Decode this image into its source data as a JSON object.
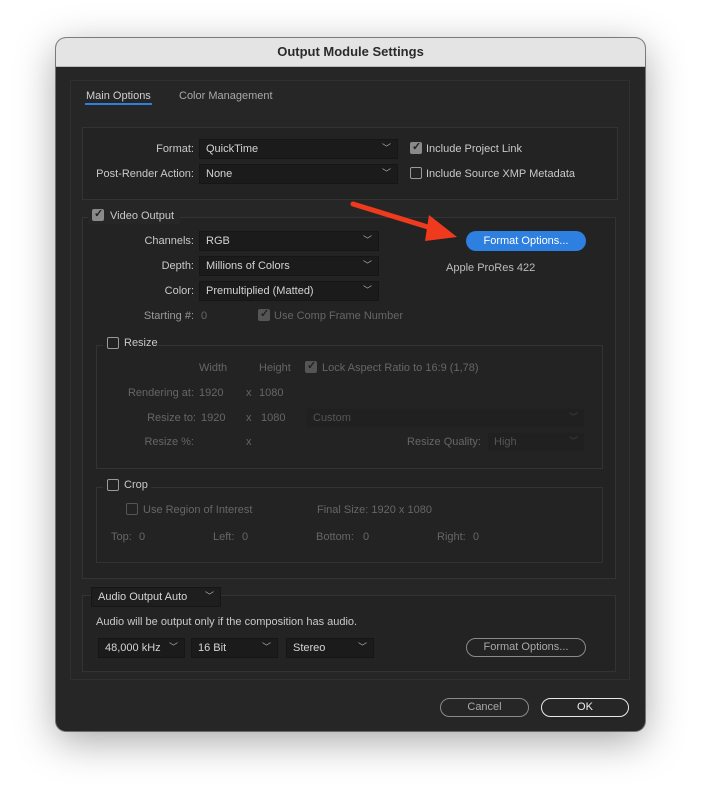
{
  "window": {
    "title": "Output Module Settings"
  },
  "tabs": [
    {
      "label": "Main Options",
      "active": true
    },
    {
      "label": "Color Management",
      "active": false
    }
  ],
  "main": {
    "format_label": "Format:",
    "format_value": "QuickTime",
    "post_render_label": "Post-Render Action:",
    "post_render_value": "None",
    "include_project_link": {
      "label": "Include Project Link",
      "checked": true
    },
    "include_xmp": {
      "label": "Include Source XMP Metadata",
      "checked": false
    }
  },
  "video": {
    "label": "Video Output",
    "checked": true,
    "channels_label": "Channels:",
    "channels_value": "RGB",
    "depth_label": "Depth:",
    "depth_value": "Millions of Colors",
    "color_label": "Color:",
    "color_value": "Premultiplied (Matted)",
    "starting_label": "Starting #:",
    "starting_value": "0",
    "use_comp_frame": {
      "label": "Use Comp Frame Number",
      "checked": true
    },
    "format_options_label": "Format Options...",
    "codec": "Apple ProRes 422",
    "accent": "#2d7fe0"
  },
  "resize": {
    "label": "Resize",
    "checked": false,
    "width_header": "Width",
    "height_header": "Height",
    "lock_aspect": {
      "label": "Lock Aspect Ratio to 16:9 (1,78)",
      "checked": true
    },
    "rendering_label": "Rendering at:",
    "rendering_w": "1920",
    "rendering_h": "1080",
    "resize_to_label": "Resize to:",
    "resize_to_w": "1920",
    "resize_to_h": "1080",
    "preset": "Custom",
    "percent_label": "Resize %:",
    "x": "x",
    "quality_label": "Resize Quality:",
    "quality_value": "High"
  },
  "crop": {
    "label": "Crop",
    "checked": false,
    "roi": {
      "label": "Use Region of Interest",
      "checked": false
    },
    "final_size": "Final Size: 1920 x 1080",
    "top_label": "Top:",
    "top": "0",
    "left_label": "Left:",
    "left": "0",
    "bottom_label": "Bottom:",
    "bottom": "0",
    "right_label": "Right:",
    "right": "0"
  },
  "audio": {
    "mode": "Audio Output Auto",
    "note": "Audio will be output only if the composition has audio.",
    "rate": "48,000 kHz",
    "bits": "16 Bit",
    "channels": "Stereo",
    "format_options_label": "Format Options..."
  },
  "footer": {
    "cancel": "Cancel",
    "ok": "OK"
  },
  "annotation": {
    "arrow_color": "#f03a1e"
  }
}
